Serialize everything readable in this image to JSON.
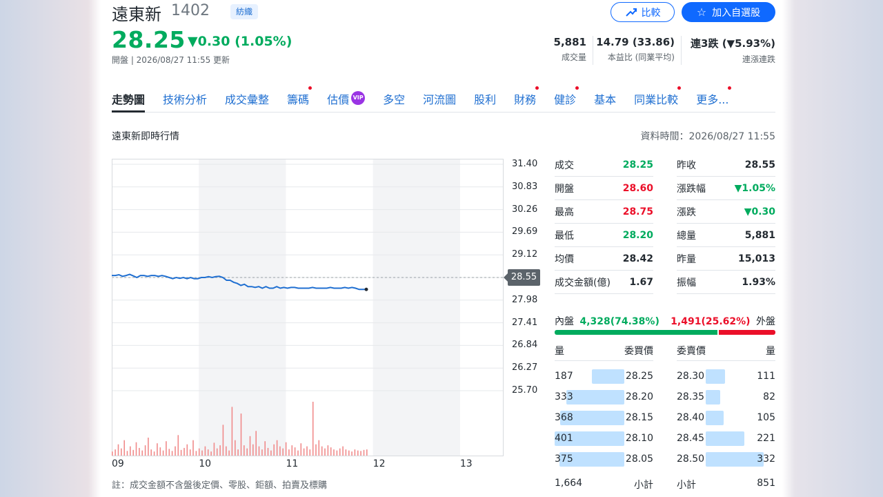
{
  "header": {
    "name": "遠東新",
    "code": "1402",
    "industry_tag": "紡織",
    "compare_label": "比較",
    "watchlist_label": "加入自選股",
    "price": "28.25",
    "change": "▼0.30 (1.05%)",
    "market_state": "開盤 | 2026/08/27 11:55 更新"
  },
  "stats": [
    {
      "value": "5,881",
      "label": "成交量"
    },
    {
      "value": "14.79 (33.86)",
      "label": "本益比 (同業平均)"
    },
    {
      "value": "連3跌 (▼5.93%)",
      "label": "連漲連跌"
    }
  ],
  "tabs": [
    {
      "label": "走勢圖",
      "active": true,
      "dot": false,
      "vip": false
    },
    {
      "label": "技術分析",
      "active": false,
      "dot": false,
      "vip": false
    },
    {
      "label": "成交彙整",
      "active": false,
      "dot": false,
      "vip": false
    },
    {
      "label": "籌碼",
      "active": false,
      "dot": true,
      "vip": false
    },
    {
      "label": "估價",
      "active": false,
      "dot": false,
      "vip": true
    },
    {
      "label": "多空",
      "active": false,
      "dot": false,
      "vip": false
    },
    {
      "label": "河流圖",
      "active": false,
      "dot": false,
      "vip": false
    },
    {
      "label": "股利",
      "active": false,
      "dot": false,
      "vip": false
    },
    {
      "label": "財務",
      "active": false,
      "dot": true,
      "vip": false
    },
    {
      "label": "健診",
      "active": false,
      "dot": true,
      "vip": false
    },
    {
      "label": "基本",
      "active": false,
      "dot": false,
      "vip": false
    },
    {
      "label": "同業比較",
      "active": false,
      "dot": true,
      "vip": false
    },
    {
      "label": "更多...",
      "active": false,
      "dot": true,
      "vip": false
    }
  ],
  "vip_label": "VIP",
  "section_title": "遠東新即時行情",
  "data_time": "資料時間：2026/08/27 11:55",
  "chart_data": {
    "type": "line",
    "y_ticks": [
      "31.40",
      "30.83",
      "30.26",
      "29.69",
      "29.12",
      "28.55",
      "27.98",
      "27.41",
      "26.84",
      "26.27",
      "25.70"
    ],
    "ylim": [
      25.7,
      31.4
    ],
    "prev_close": "28.55",
    "x_ticks": [
      "09",
      "10",
      "11",
      "12",
      "13"
    ],
    "price_series": [
      28.6,
      28.6,
      28.62,
      28.58,
      28.6,
      28.63,
      28.59,
      28.55,
      28.6,
      28.6,
      28.58,
      28.6,
      28.6,
      28.58,
      28.6,
      28.58,
      28.55,
      28.52,
      28.55,
      28.53,
      28.55,
      28.52,
      28.55,
      28.52,
      28.52,
      28.55,
      28.55,
      28.57,
      28.55,
      28.57,
      28.58,
      28.55,
      28.48,
      28.48,
      28.43,
      28.4,
      28.35,
      28.38,
      28.32,
      28.32,
      28.3,
      28.32,
      28.28,
      28.32,
      28.28,
      28.28,
      28.32,
      28.28,
      28.3,
      28.28,
      28.3,
      28.3,
      28.28,
      28.28,
      28.28,
      28.28,
      28.3,
      28.28,
      28.28,
      28.28,
      28.28,
      28.3,
      28.28,
      28.28,
      28.28,
      28.3,
      28.28,
      28.3,
      28.28,
      28.25,
      28.25,
      28.25
    ],
    "volume_series": [
      8,
      12,
      22,
      14,
      30,
      9,
      18,
      11,
      26,
      15,
      10,
      20,
      35,
      12,
      8,
      24,
      16,
      10,
      28,
      13,
      9,
      18,
      40,
      11,
      15,
      22,
      12,
      30,
      9,
      14,
      10,
      18,
      12,
      8,
      25,
      14,
      20,
      60,
      18,
      10,
      95,
      30,
      12,
      82,
      20,
      14,
      38,
      22,
      48,
      18,
      12,
      28,
      15,
      10,
      22,
      30,
      18,
      14,
      26,
      12,
      20,
      16,
      10,
      24,
      14,
      18,
      12,
      105,
      22,
      30,
      18,
      14,
      20,
      16,
      12,
      10,
      14,
      18,
      12,
      10,
      8,
      12,
      10,
      9,
      11,
      12
    ]
  },
  "note": "註：成交金額不含盤後定價、零股、鉅額、拍賣及標購",
  "quote_left": [
    {
      "label": "成交",
      "value": "28.25",
      "color": "green"
    },
    {
      "label": "開盤",
      "value": "28.60",
      "color": "red"
    },
    {
      "label": "最高",
      "value": "28.75",
      "color": "red"
    },
    {
      "label": "最低",
      "value": "28.20",
      "color": "green"
    },
    {
      "label": "均價",
      "value": "28.42",
      "color": "dark"
    },
    {
      "label": "成交金額(億)",
      "value": "1.67",
      "color": "dark"
    }
  ],
  "quote_right": [
    {
      "label": "昨收",
      "value": "28.55",
      "color": "dark"
    },
    {
      "label": "漲跌幅",
      "value": "▼1.05%",
      "color": "green"
    },
    {
      "label": "漲跌",
      "value": "▼0.30",
      "color": "green"
    },
    {
      "label": "總量",
      "value": "5,881",
      "color": "dark"
    },
    {
      "label": "昨量",
      "value": "15,013",
      "color": "dark"
    },
    {
      "label": "振幅",
      "value": "1.93%",
      "color": "dark"
    }
  ],
  "inner_outer": {
    "inner_label": "內盤",
    "inner_value": "4,328(74.38%)",
    "outer_value": "1,491(25.62%)",
    "outer_label": "外盤",
    "inner_ratio": 0.7438
  },
  "order_book": {
    "bid_qty_header": "量",
    "bid_price_header": "委買價",
    "ask_price_header": "委賣價",
    "ask_qty_header": "量",
    "bids": [
      {
        "qty": "187",
        "price": "28.25",
        "q": 187
      },
      {
        "qty": "333",
        "price": "28.20",
        "q": 333
      },
      {
        "qty": "368",
        "price": "28.15",
        "q": 368
      },
      {
        "qty": "401",
        "price": "28.10",
        "q": 401
      },
      {
        "qty": "375",
        "price": "28.05",
        "q": 375
      }
    ],
    "asks": [
      {
        "price": "28.30",
        "qty": "111",
        "q": 111
      },
      {
        "price": "28.35",
        "qty": "82",
        "q": 82
      },
      {
        "price": "28.40",
        "qty": "105",
        "q": 105
      },
      {
        "price": "28.45",
        "qty": "221",
        "q": 221
      },
      {
        "price": "28.50",
        "qty": "332",
        "q": 332
      }
    ],
    "bid_subtotal": "1,664",
    "bid_subtotal_label": "小計",
    "ask_subtotal_label": "小計",
    "ask_subtotal": "851"
  },
  "colors": {
    "up": "#eb0f29",
    "down": "#00ab5e",
    "accent": "#0f69ff",
    "line": "#1f6fd1",
    "volume": "#f08a8a",
    "bar_book": "#bfe1ff"
  }
}
